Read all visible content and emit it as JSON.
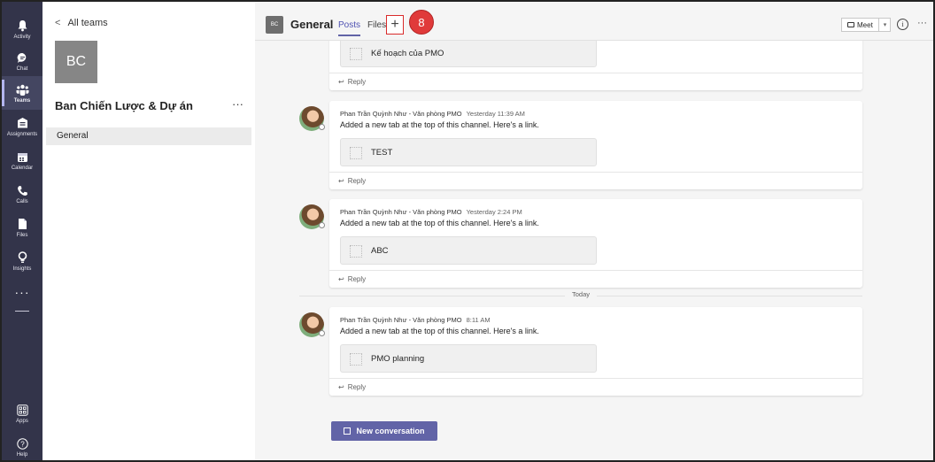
{
  "rail": {
    "items": [
      {
        "label": "Activity",
        "icon": "bell-icon"
      },
      {
        "label": "Chat",
        "icon": "chat-icon"
      },
      {
        "label": "Teams",
        "icon": "teams-icon"
      },
      {
        "label": "Assignments",
        "icon": "assignments-icon"
      },
      {
        "label": "Calendar",
        "icon": "calendar-icon"
      },
      {
        "label": "Calls",
        "icon": "phone-icon"
      },
      {
        "label": "Files",
        "icon": "file-icon"
      },
      {
        "label": "Insights",
        "icon": "lightbulb-icon"
      }
    ],
    "more": "···",
    "bottom": [
      {
        "label": "Apps",
        "icon": "apps-icon"
      },
      {
        "label": "Help",
        "icon": "help-icon"
      }
    ],
    "active_label": "Teams"
  },
  "teams_pane": {
    "back_label": "All teams",
    "avatar_initials": "BC",
    "team_name": "Ban Chiến Lược & Dự án",
    "more": "···",
    "channel": "General"
  },
  "header": {
    "avatar_initials": "BC",
    "title": "General",
    "tab_posts": "Posts",
    "tab_files": "Files",
    "add_tab": "+",
    "step_badge": "8",
    "meet_label": "Meet",
    "info": "i",
    "more": "···"
  },
  "feed": {
    "top_card": {
      "tab_label": "Kế hoạch của PMO",
      "reply": "Reply"
    },
    "posts": [
      {
        "sender": "Phan Trần Quỳnh Như - Văn phòng PMO",
        "time": "Yesterday 11:39 AM",
        "message": "Added a new tab at the top of this channel. Here's a link.",
        "tab_label": "TEST",
        "reply": "Reply"
      },
      {
        "sender": "Phan Trần Quỳnh Như - Văn phòng PMO",
        "time": "Yesterday 2:24 PM",
        "message": "Added a new tab at the top of this channel. Here's a link.",
        "tab_label": "ABC",
        "reply": "Reply"
      },
      {
        "sender": "Phan Trần Quỳnh Như - Văn phòng PMO",
        "time": "8:11 AM",
        "message": "Added a new tab at the top of this channel. Here's a link.",
        "tab_label": "PMO planning",
        "reply": "Reply"
      }
    ],
    "day_separator": "Today",
    "new_conversation": "New conversation"
  },
  "colors": {
    "rail_bg": "#33344a",
    "accent": "#6264a7",
    "badge": "#e03a3a"
  }
}
